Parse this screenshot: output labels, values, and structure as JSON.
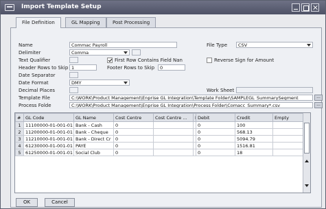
{
  "window": {
    "title": "Import Template Setup"
  },
  "tabs": [
    {
      "label": "File Definition"
    },
    {
      "label": "GL Mapping"
    },
    {
      "label": "Post Processing"
    }
  ],
  "form": {
    "name_label": "Name",
    "name_value": "Commac Payroll",
    "file_type_label": "File Type",
    "file_type_value": "CSV",
    "delimiter_label": "Delimiter",
    "delimiter_value": "Comma",
    "text_qualifier_label": "Text Qualifier",
    "first_row_label": "First Row Contains Field Nan",
    "first_row_checked": true,
    "reverse_sign_label": "Reverse Sign for Amount",
    "reverse_sign_checked": false,
    "header_rows_label": "Header Rows to Skip",
    "header_rows_value": "1",
    "footer_rows_label": "Footer Rows to Skip",
    "footer_rows_value": "0",
    "date_separator_label": "Date Separator",
    "date_format_label": "Date Format",
    "date_format_value": "DMY",
    "decimal_places_label": "Decimal Places",
    "work_sheet_label": "Work Sheet",
    "template_file_label": "Template File",
    "template_file_value": "C:\\WORK\\Product Management\\Enprise GL Integration\\Template Folder\\SAMPLEGL_SummarySegment",
    "process_folder_label": "Process Folde",
    "process_folder_value": "C:\\WORK\\Product Management\\Enprise GL Integration\\Process Folder\\Comacc_Summary*.csv",
    "browse_label": "..."
  },
  "grid": {
    "columns": [
      "#",
      "GL Code",
      "GL Name",
      "Cost Centre",
      "Cost Centre ...",
      "D",
      "Debit",
      "Credit",
      "Empty"
    ],
    "rows": [
      [
        "1",
        "11100000-01-001-01",
        "Bank - Cash",
        "0",
        "",
        "",
        "0",
        "100",
        ""
      ],
      [
        "2",
        "11200000-01-001-01",
        "Bank - Cheque",
        "0",
        "",
        "",
        "0",
        "568.13",
        ""
      ],
      [
        "3",
        "11210000-01-001-01",
        "Bank - Direct Cr",
        "0",
        "",
        "",
        "0",
        "5094.79",
        ""
      ],
      [
        "4",
        "61230000-01-001-01",
        "PAYE",
        "0",
        "",
        "",
        "0",
        "1516.81",
        ""
      ],
      [
        "5",
        "61250000-01-001-01",
        "Social Club",
        "0",
        "",
        "",
        "0",
        "18",
        ""
      ]
    ]
  },
  "buttons": {
    "ok_label": "OK",
    "cancel_label": "Cancel"
  }
}
